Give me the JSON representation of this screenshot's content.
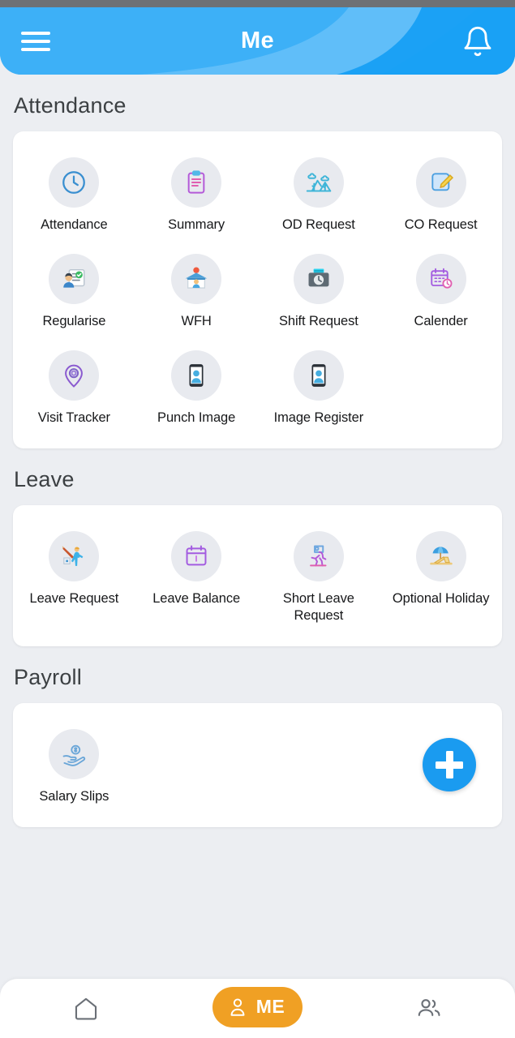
{
  "header": {
    "title": "Me",
    "menu_icon": "hamburger-menu-icon",
    "notification_icon": "bell-icon",
    "background_color": "#3db0f7"
  },
  "sections": [
    {
      "title": "Attendance",
      "items": [
        {
          "label": "Attendance",
          "icon": "clock-icon"
        },
        {
          "label": "Summary",
          "icon": "clipboard-list-icon"
        },
        {
          "label": "OD Request",
          "icon": "outdoor-mountains-icon"
        },
        {
          "label": "CO Request",
          "icon": "square-pencil-edit-icon"
        },
        {
          "label": "Regularise",
          "icon": "person-checklist-icon"
        },
        {
          "label": "WFH",
          "icon": "person-in-house-icon"
        },
        {
          "label": "Shift Request",
          "icon": "briefcase-clock-icon"
        },
        {
          "label": "Calender",
          "icon": "calendar-clock-icon"
        },
        {
          "label": "Visit Tracker",
          "icon": "location-pin-icon"
        },
        {
          "label": "Punch Image",
          "icon": "phone-person-icon"
        },
        {
          "label": "Image Register",
          "icon": "phone-person-icon"
        }
      ]
    },
    {
      "title": "Leave",
      "items": [
        {
          "label": "Leave Request",
          "icon": "person-walking-out-icon"
        },
        {
          "label": "Leave Balance",
          "icon": "calendar-icon"
        },
        {
          "label": "Short Leave Request",
          "icon": "person-running-icon"
        },
        {
          "label": "Optional Holiday",
          "icon": "beach-umbrella-icon"
        }
      ]
    },
    {
      "title": "Payroll",
      "items": [
        {
          "label": "Salary Slips",
          "icon": "hand-coin-icon"
        }
      ]
    }
  ],
  "fab": {
    "icon": "plus-icon",
    "color": "#1a9bf0"
  },
  "bottom_nav": {
    "items": [
      {
        "label": "",
        "icon": "home-icon",
        "active": false
      },
      {
        "label": "ME",
        "icon": "person-icon",
        "active": true
      },
      {
        "label": "",
        "icon": "people-group-icon",
        "active": false
      }
    ],
    "active_color": "#f0a024"
  }
}
